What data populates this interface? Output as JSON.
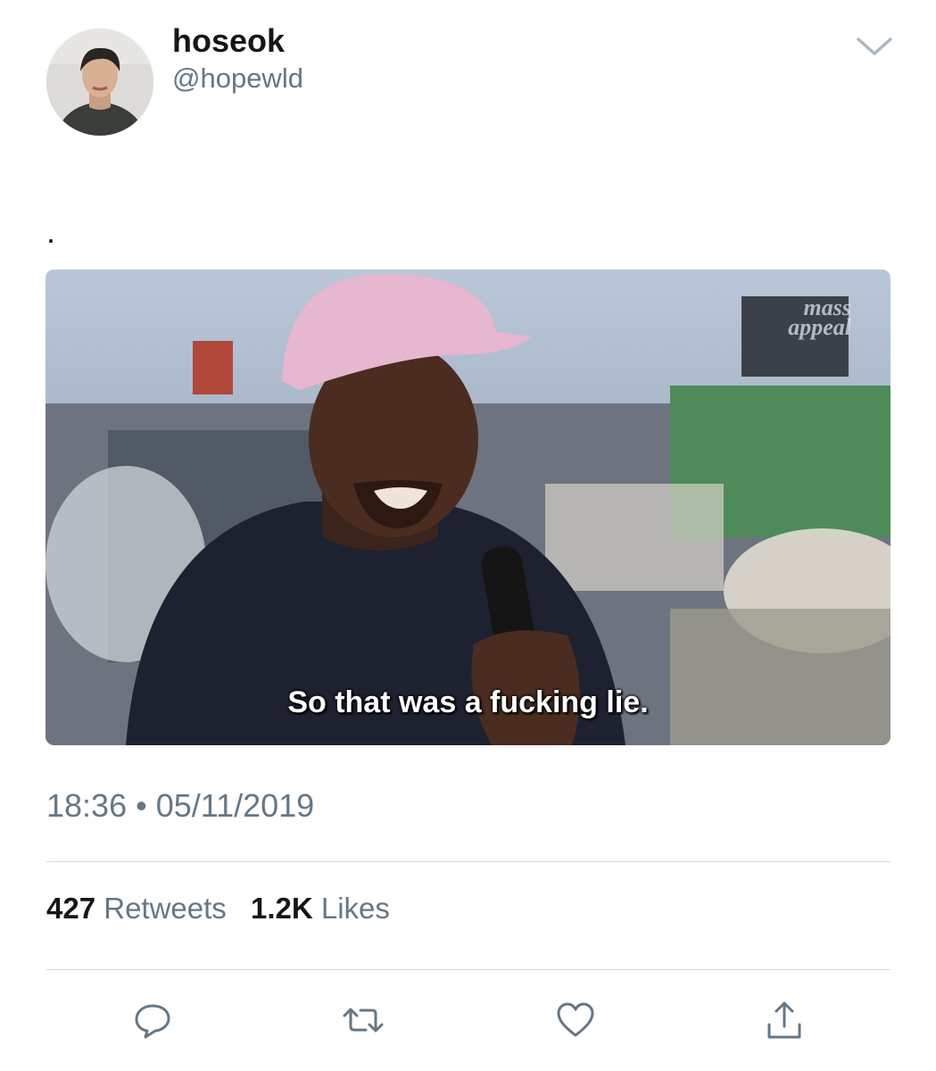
{
  "user": {
    "name": "hoseok",
    "handle": "@hopewld"
  },
  "tweet": {
    "text": ".",
    "media": {
      "subtitle": "So that was a fucking lie.",
      "watermark_line1": "mass",
      "watermark_line2": "appeal"
    },
    "timestamp": "18:36 • 05/11/2019"
  },
  "stats": {
    "retweets_count": "427",
    "retweets_label": "Retweets",
    "likes_count": "1.2K",
    "likes_label": "Likes"
  },
  "actions": {
    "icons": [
      "reply-icon",
      "retweet-icon",
      "like-icon",
      "share-icon"
    ]
  },
  "colors": {
    "text_primary": "#14171a",
    "text_secondary": "#657786",
    "divider": "#d3d9de",
    "icon": "#657786"
  }
}
